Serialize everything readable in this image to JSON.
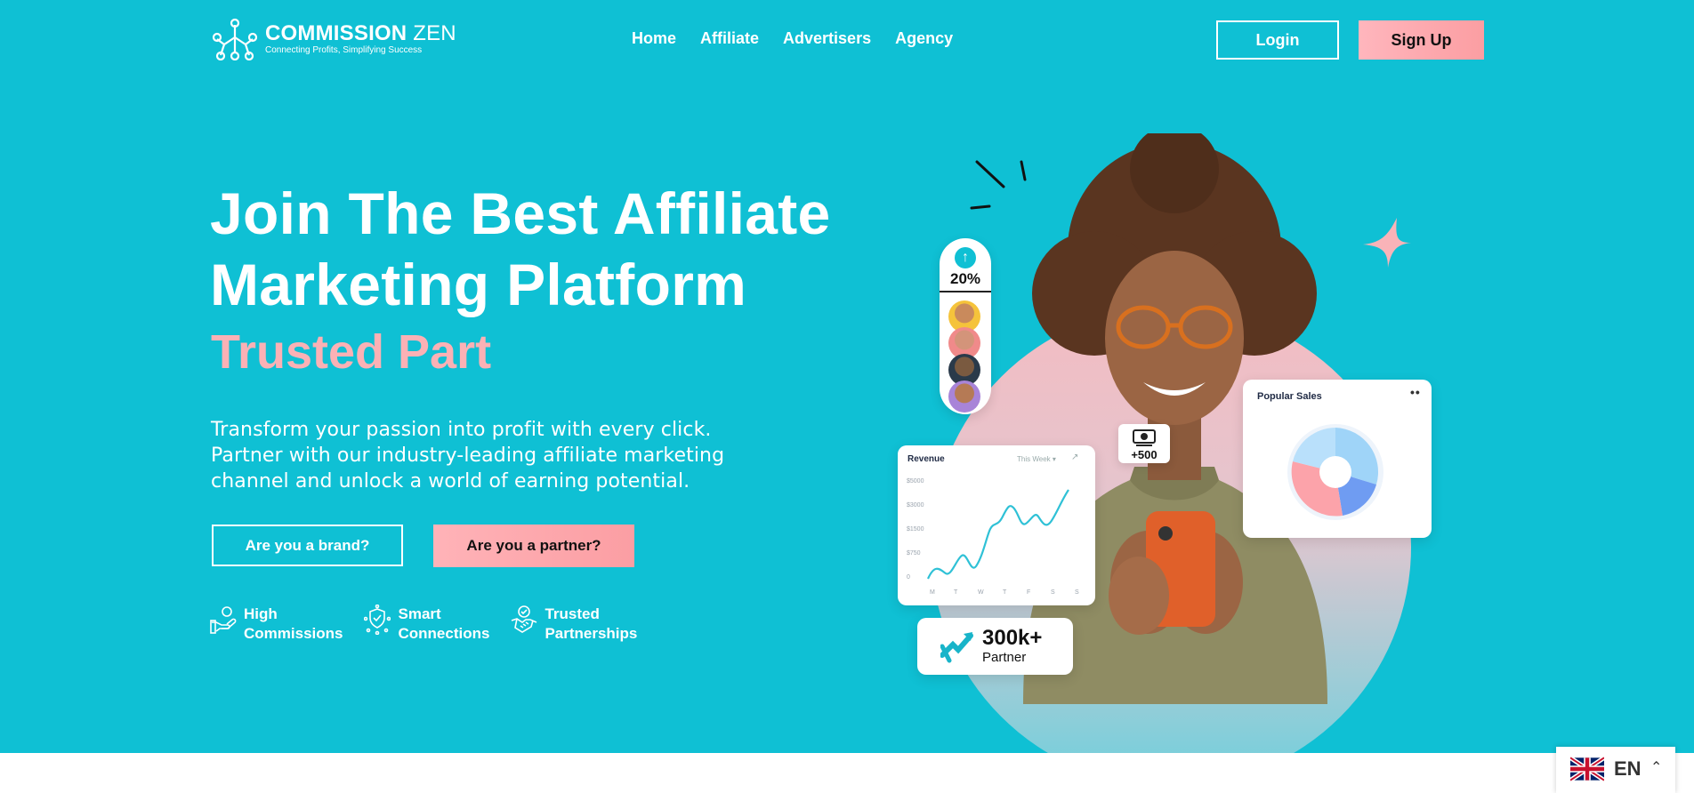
{
  "header": {
    "logo": {
      "name_bold": "COMMISSION",
      "name_light": "ZEN",
      "tagline": "Connecting Profits, Simplifying Success",
      "icon": "network-nodes-icon"
    },
    "nav": [
      {
        "label": "Home"
      },
      {
        "label": "Affiliate"
      },
      {
        "label": "Advertisers"
      },
      {
        "label": "Agency"
      }
    ],
    "login_label": "Login",
    "signup_label": "Sign Up"
  },
  "hero": {
    "title_line1": "Join The Best Affiliate",
    "title_line2": "Marketing Platform",
    "rotating_text": "Trusted Part",
    "lead": "Transform your passion into profit with every click. Partner with our industry-leading affiliate marketing channel and unlock a world of earning potential.",
    "brand_button": "Are you a brand?",
    "partner_button": "Are you a partner?",
    "features": [
      {
        "line1": "High",
        "line2": "Commissions",
        "icon": "hand-coin-icon"
      },
      {
        "line1": "Smart",
        "line2": "Connections",
        "icon": "shield-network-icon"
      },
      {
        "line1": "Trusted",
        "line2": "Partnerships",
        "icon": "handshake-icon"
      }
    ]
  },
  "illustration": {
    "growth_pill": {
      "percent": "20%",
      "icon": "arrow-up-icon"
    },
    "revenue_card": {
      "title": "Revenue",
      "period": "This Week",
      "y_ticks": [
        "$5000",
        "$3000",
        "$1500",
        "$750",
        "0"
      ],
      "x_ticks": [
        "M",
        "T",
        "W",
        "T",
        "F",
        "S",
        "S"
      ]
    },
    "popular_sales": {
      "title": "Popular Sales"
    },
    "cash_badge": {
      "text": "+500",
      "icon": "money-icon"
    },
    "partners_badge": {
      "number": "300k+",
      "label": "Partner",
      "icon": "handshake-arrows-icon"
    }
  },
  "language": {
    "code": "EN",
    "flag": "uk-flag-icon"
  },
  "colors": {
    "hero_bg": "#0fc0d4",
    "accent_pink": "#fbb1b5",
    "button_pink": "#fb9ea2",
    "text_dark": "#111111"
  }
}
